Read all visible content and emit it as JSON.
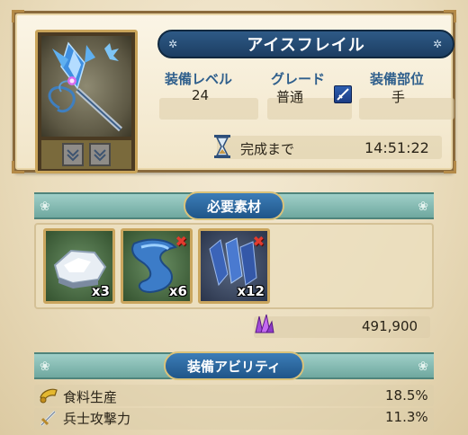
{
  "item": {
    "name": "アイスフレイル",
    "icon": "ice-flail-weapon"
  },
  "stats": {
    "level_label": "装備レベル",
    "level_value": "24",
    "grade_label": "グレード",
    "grade_value": "普通",
    "slot_label": "装備部位",
    "slot_value": "手"
  },
  "timer": {
    "label": "完成まで",
    "value": "14:51:22"
  },
  "materials": {
    "header": "必要素材",
    "items": [
      {
        "icon": "ice-ore",
        "count": "x3",
        "missing": false
      },
      {
        "icon": "blue-cloth",
        "count": "x6",
        "missing": true
      },
      {
        "icon": "blue-crystal-shards",
        "count": "x12",
        "missing": true
      }
    ],
    "missing_mark": "✖",
    "cost": "491,900"
  },
  "abilities": {
    "header": "装備アビリティ",
    "items": [
      {
        "icon": "horn-icon",
        "name": "食料生産",
        "value": "18.5%"
      },
      {
        "icon": "sword-icon",
        "name": "兵士攻撃力",
        "value": "11.3%"
      }
    ]
  },
  "colors": {
    "banner": "#1c3e62",
    "label_blue": "#2f5f8c",
    "missing_red": "#e23b2e",
    "section_teal": "#6fa89f"
  }
}
